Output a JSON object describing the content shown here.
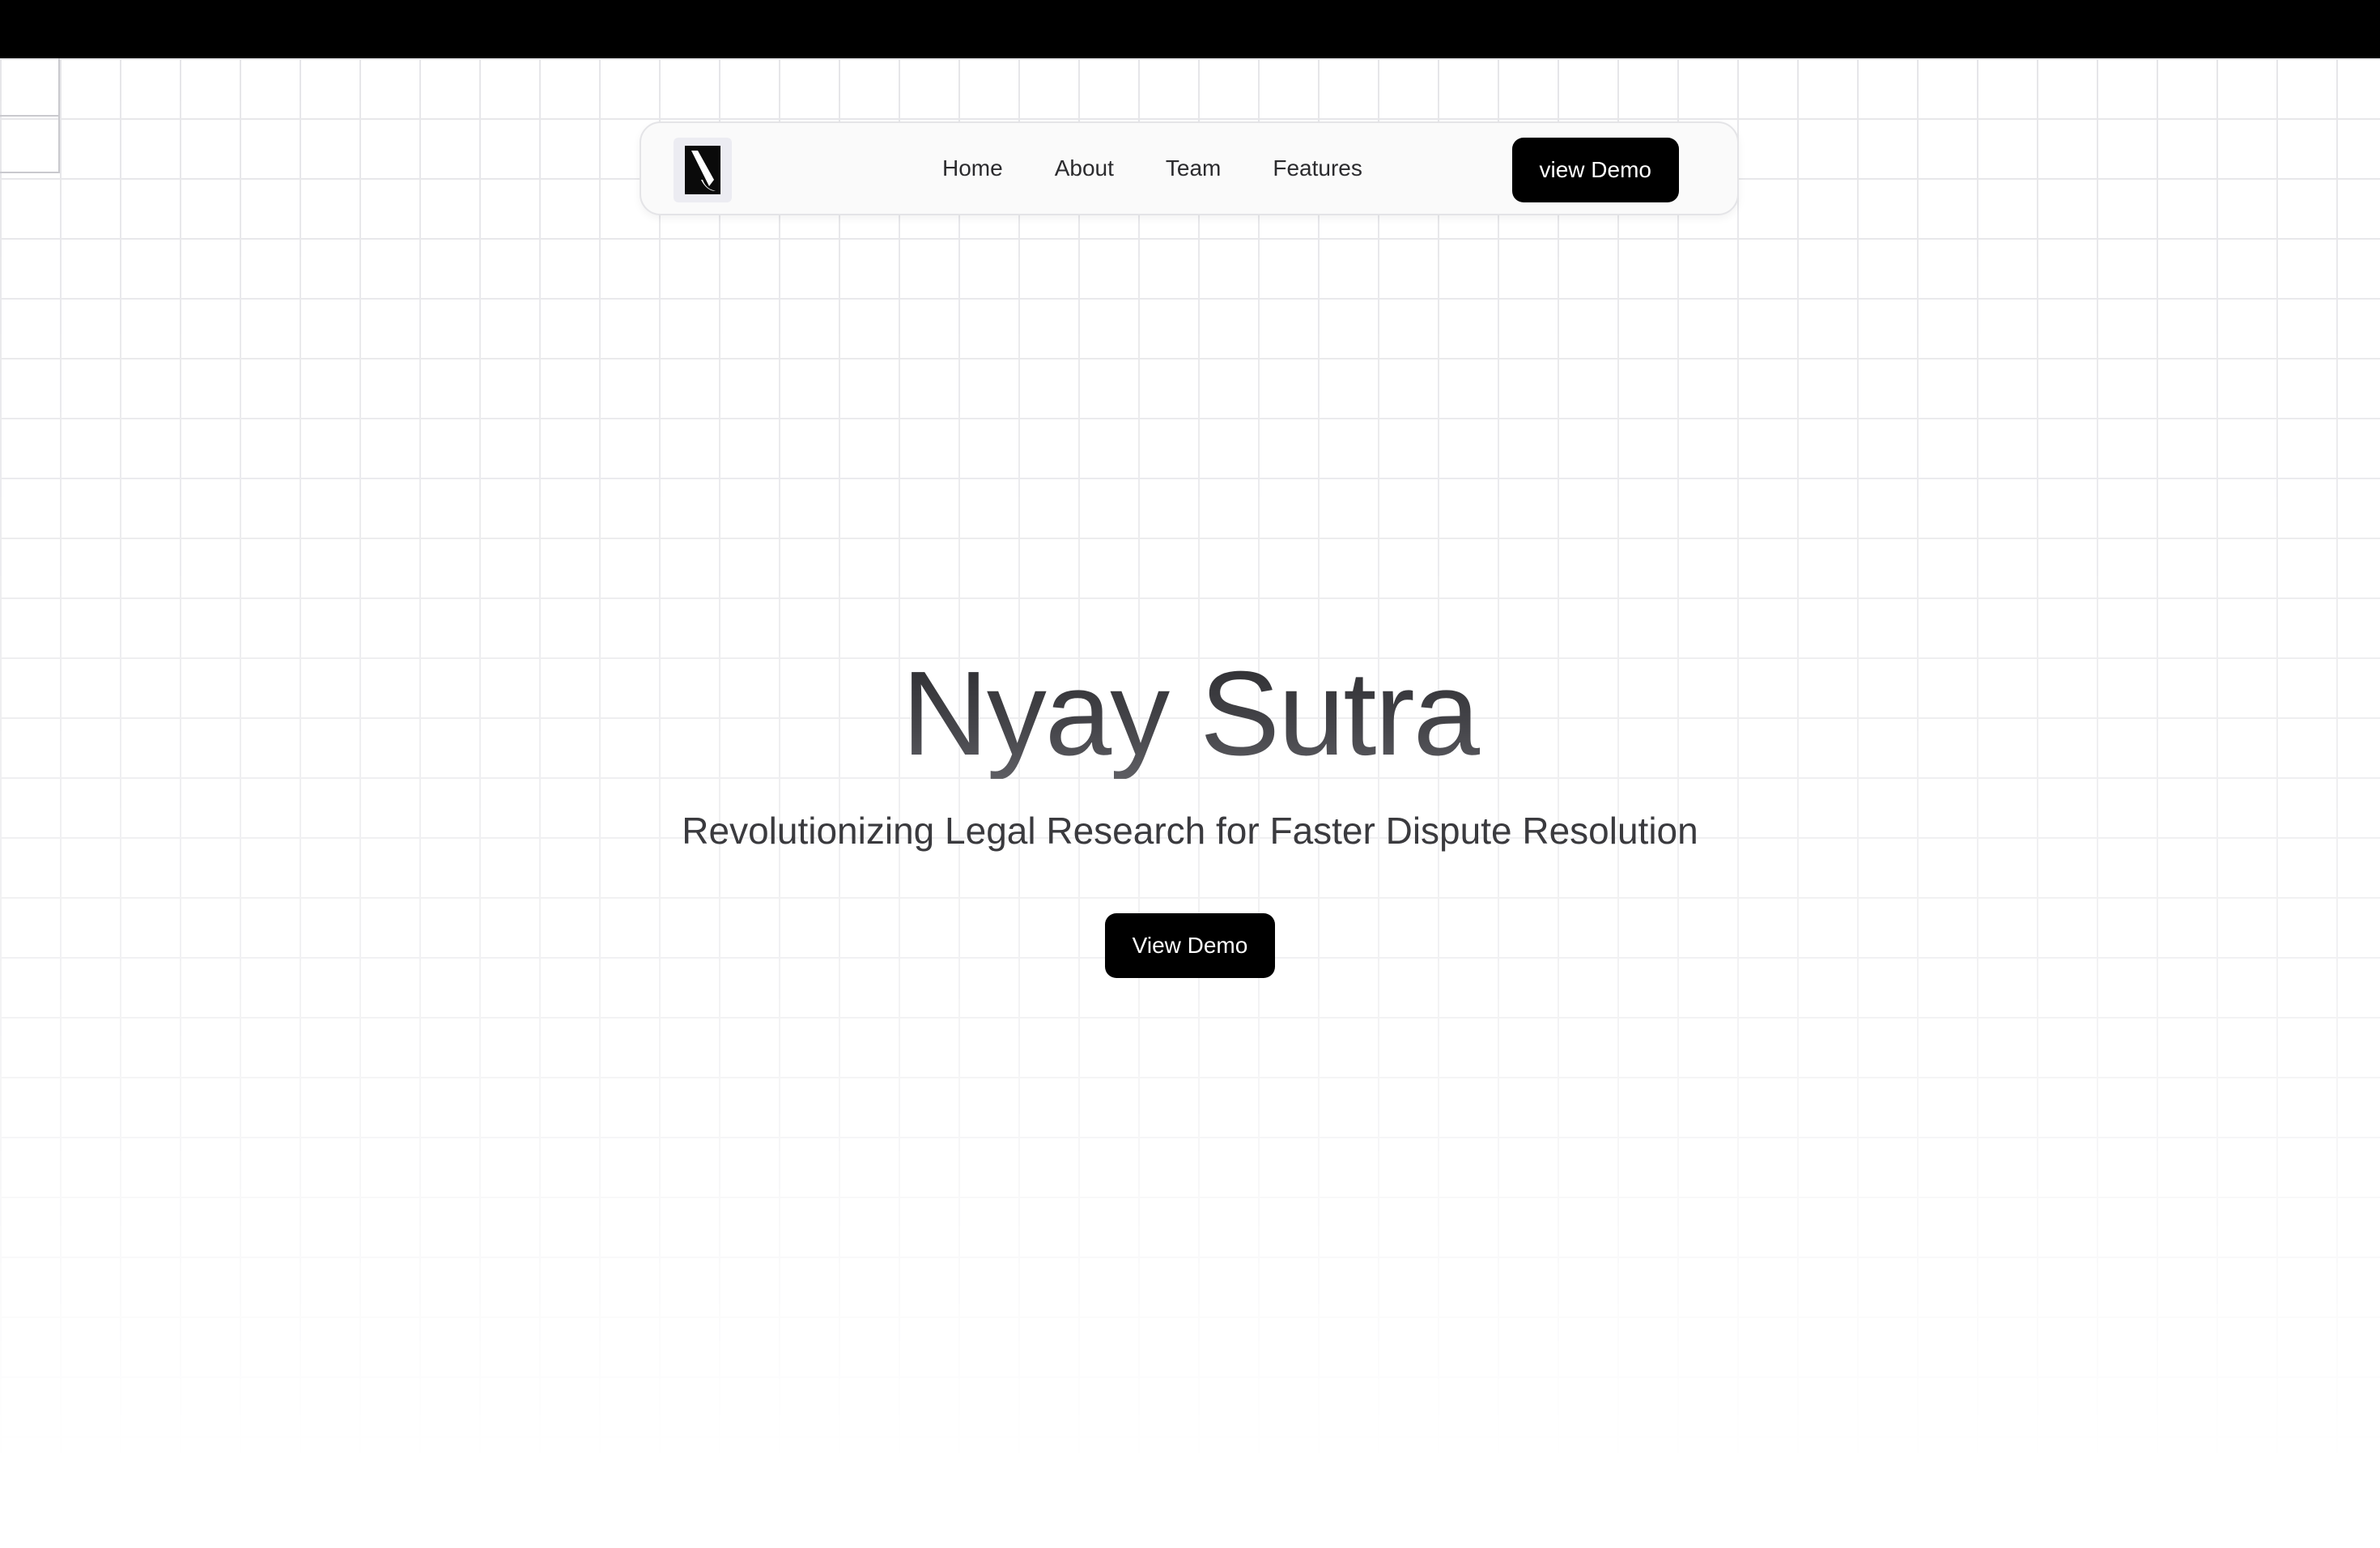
{
  "nav": {
    "logo_icon": "nyay-sutra-logo-icon",
    "links": [
      {
        "label": "Home"
      },
      {
        "label": "About"
      },
      {
        "label": "Team"
      },
      {
        "label": "Features"
      }
    ],
    "cta_label": "view Demo"
  },
  "hero": {
    "title": "Nyay Sutra",
    "subtitle": "Revolutionizing Legal Research for Faster Dispute Resolution",
    "cta_label": "View Demo"
  },
  "colors": {
    "background": "#ffffff",
    "top_bar": "#000000",
    "button_bg": "#000000",
    "button_text": "#ffffff",
    "grid_line": "#e6e6e9",
    "text_primary": "#2c2c2f"
  }
}
